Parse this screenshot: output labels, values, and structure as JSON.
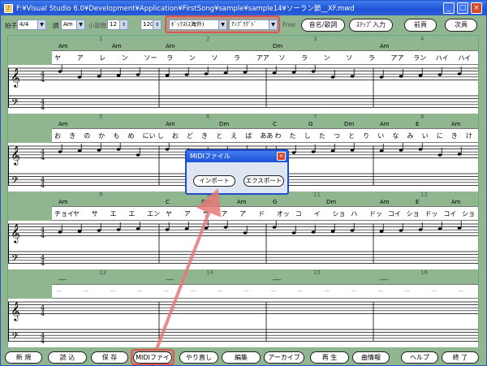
{
  "titlebar": {
    "title": "F:¥Visual Studio 6.0¥Development¥Application¥FirstSong¥sample¥sample14¥ソーラン節__XF.mwd",
    "minimize": "_",
    "maximize": "□",
    "close": "×"
  },
  "toolbar": {
    "time_sig_label": "拍子",
    "time_sig_value": "4/4",
    "key_label": "調",
    "key_value": "Am",
    "bars_label": "小節数",
    "bars_value": "12",
    "tempo_value": "120",
    "instrument_value": "ﾎﾞｯｸｽ(ｽ海外)",
    "arrange_value": "ｱﾝﾌﾟﾗｸﾞﾄﾞ",
    "free_label": "Free",
    "btn_notename": "音名/歌詞",
    "btn_step": "ｽﾃｯﾌﾟ入力",
    "btn_prev": "前頁",
    "btn_next": "次頁"
  },
  "systems": [
    {
      "measures": [
        "1",
        "2",
        "3",
        "4"
      ],
      "chords": [
        [
          "Am",
          "Am"
        ],
        [
          "Am"
        ],
        [
          "Dm"
        ],
        [
          "Am"
        ]
      ],
      "lyrics": [
        "ヤ",
        "ア",
        "レ",
        "ン",
        "ソ|ー",
        "ラ",
        "ン",
        "ソ",
        "ラ",
        "ア|ア",
        "ソ",
        "ラ",
        "ン",
        "ソ",
        "ラ",
        "ア|ア",
        "ラ|ン",
        "ハ|イ",
        "ハ|イ"
      ]
    },
    {
      "measures": [
        "5",
        "6",
        "7",
        "8"
      ],
      "chords": [
        [
          "Am"
        ],
        [
          "Am",
          "Dm"
        ],
        [
          "C",
          "G",
          "Dm"
        ],
        [
          "Am",
          "E",
          "Am"
        ]
      ],
      "lyrics": [
        "お",
        "き",
        "の",
        "か",
        "も",
        "め",
        "に|い",
        "し",
        "お",
        "ど",
        "き",
        "と",
        "え",
        "ば",
        "あ|あ",
        "わ",
        "た",
        "し",
        "た",
        "つ",
        "と",
        "り",
        "い",
        "な",
        "み",
        "い",
        "に",
        "き",
        "け"
      ]
    },
    {
      "measures": [
        "9",
        "10",
        "11",
        "12"
      ],
      "chords": [
        [
          "Am"
        ],
        [
          "C",
          "Dm",
          "Am"
        ],
        [
          "G",
          "Dm"
        ],
        [
          "Am",
          "E",
          "Am"
        ]
      ],
      "lyrics": [
        "チョ|イ",
        "ヤ",
        "サ",
        "エ",
        "エ",
        "エ|ン",
        "ヤ",
        "ア",
        "サ",
        "ア",
        "ア",
        "ド",
        "オッ",
        "コ",
        "イ",
        "ショ",
        "ハ",
        "ドッ",
        "コイ",
        "ショ",
        "ドッ",
        "コイ",
        "ショ"
      ]
    },
    {
      "measures": [
        "13",
        "14",
        "15",
        "16"
      ],
      "chords": [
        [
          "----"
        ],
        [
          "----"
        ],
        [
          "----"
        ],
        [
          "----"
        ]
      ],
      "lyrics": []
    }
  ],
  "dialog": {
    "title": "MIDIファイル",
    "close": "×",
    "import": "インポート",
    "export": "エクスポート"
  },
  "footer": {
    "new": "新 規",
    "read": "読 込",
    "save": "保 存",
    "midi": "MIDIファイル",
    "redo": "やり直し",
    "edit": "編集",
    "archive": "アーカイブ",
    "play": "再 生",
    "info": "曲情報",
    "help": "ヘルプ",
    "exit": "終 了"
  },
  "colors": {
    "bg": "#8fb68f",
    "highlight": "#e07070",
    "dialog_border": "#1f4dcc"
  }
}
